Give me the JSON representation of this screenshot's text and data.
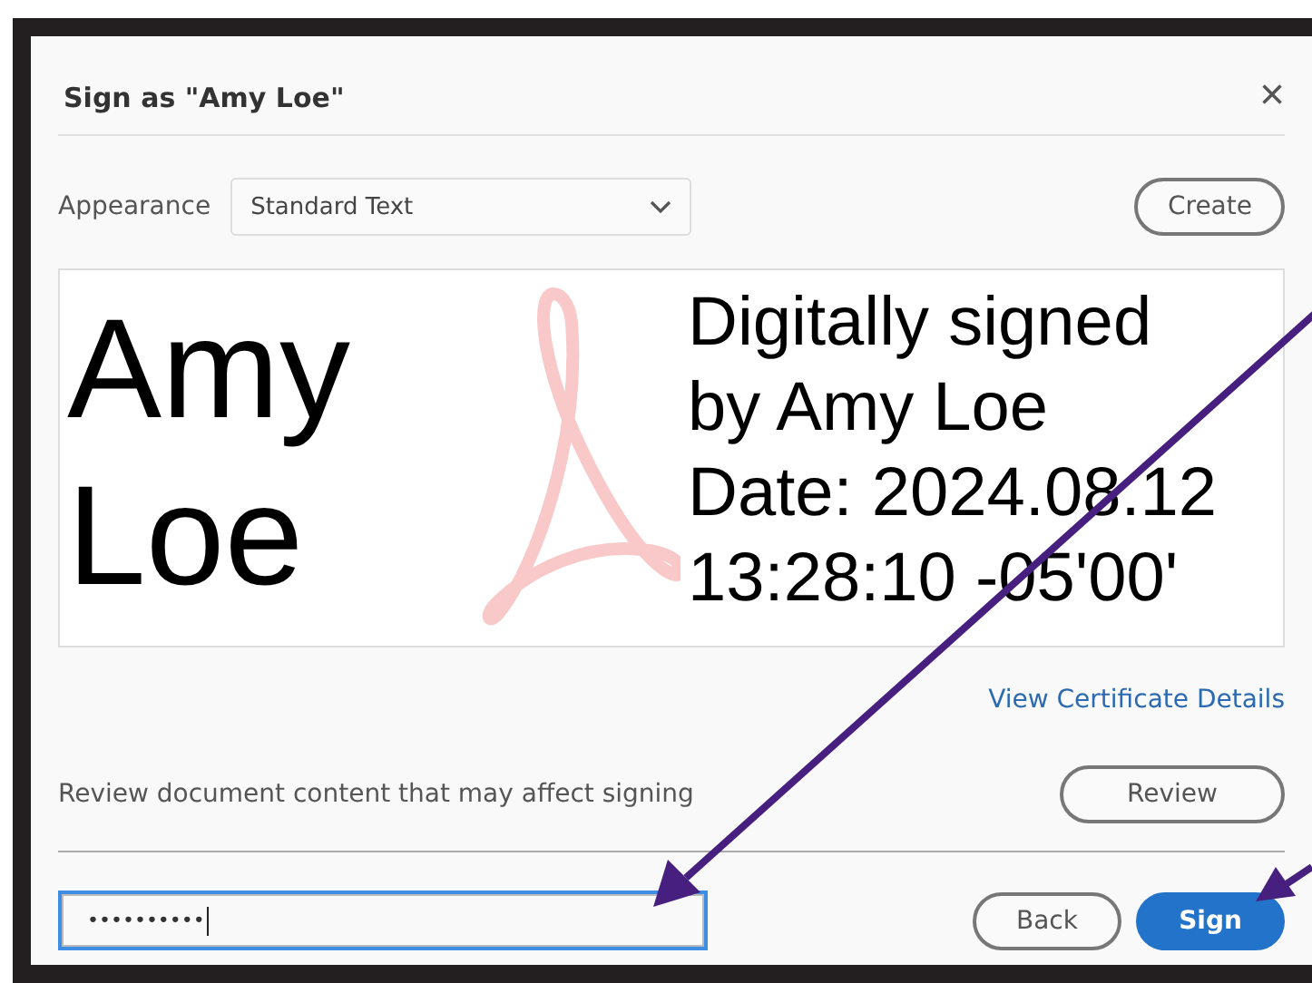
{
  "dialog": {
    "title": "Sign as \"Amy Loe\"",
    "close": "×"
  },
  "appearance": {
    "label": "Appearance",
    "value": "Standard Text",
    "create": "Create"
  },
  "preview": {
    "name_lines": [
      "Amy",
      "Loe"
    ],
    "detail_lines": [
      "Digitally signed",
      "by Amy Loe",
      "Date: 2024.08.12",
      "13:28:10 -05'00'"
    ]
  },
  "certificate_link": "View Certificate Details",
  "review": {
    "text": "Review document content that may affect signing",
    "button": "Review"
  },
  "password": {
    "value": "••••••••••",
    "focused": true
  },
  "buttons": [
    {
      "label": "Back",
      "kind": "secondary"
    },
    {
      "label": "Sign",
      "kind": "primary"
    }
  ]
}
